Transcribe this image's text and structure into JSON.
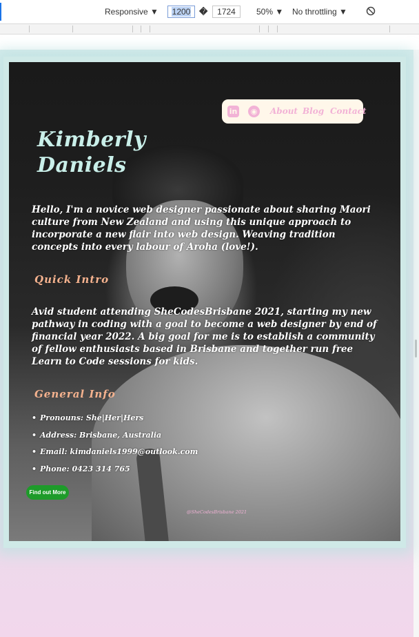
{
  "devtools": {
    "device": "Responsive",
    "width": "1200",
    "times": "�",
    "height": "1724",
    "zoom": "50%",
    "throttling": "No throttling"
  },
  "nav": {
    "linkedin_glyph": "in",
    "github_glyph": "◉",
    "links": [
      "About",
      "Blog",
      "Contact"
    ]
  },
  "page": {
    "title_line1": "Kimberly",
    "title_line2": "Daniels",
    "intro": "Hello, I'm a novice web designer passionate about sharing Maori culture from New Zealand and using this unique approach to incorporate a new flair into web design. Weaving tradition concepts into every labour of Aroha (love!).",
    "quick_intro_heading": "Quick Intro",
    "quick_intro_text": "Avid student attending SheCodesBrisbane 2021, starting my new pathway in coding with a goal to become a web designer by end of financial year 2022. A big goal for me is to establish a community of fellow enthusiasts based in Brisbane and together run free Learn to Code sessions for kids.",
    "general_info_heading": "General Info",
    "info_items": [
      "Pronouns: She|Her|Hers",
      "Address: Brisbane, Australia",
      "Email: kimdaniels1999@outlook.com",
      "Phone: 0423 314 765"
    ],
    "button_label": "Find out More",
    "footer": "@SheCodesBrisbane 2021"
  },
  "colors": {
    "title": "#c9efe9",
    "heading": "#f5b28e",
    "nav_bg": "#fff7ea",
    "nav_link": "#f2b2d6",
    "button": "#1e9b2a"
  }
}
